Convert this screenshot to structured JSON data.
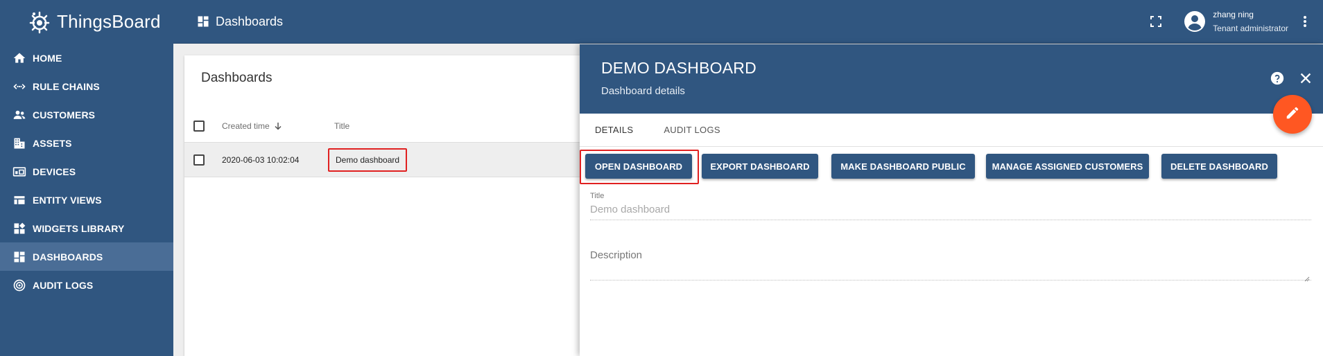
{
  "app": {
    "name": "ThingsBoard"
  },
  "sidebar": {
    "items": [
      {
        "label": "HOME",
        "icon": "home-icon"
      },
      {
        "label": "RULE CHAINS",
        "icon": "rule-chains-icon"
      },
      {
        "label": "CUSTOMERS",
        "icon": "customers-icon"
      },
      {
        "label": "ASSETS",
        "icon": "assets-icon"
      },
      {
        "label": "DEVICES",
        "icon": "devices-icon"
      },
      {
        "label": "ENTITY VIEWS",
        "icon": "entity-views-icon"
      },
      {
        "label": "WIDGETS LIBRARY",
        "icon": "widgets-library-icon"
      },
      {
        "label": "DASHBOARDS",
        "icon": "dashboards-icon",
        "active": true
      },
      {
        "label": "AUDIT LOGS",
        "icon": "audit-logs-icon"
      }
    ]
  },
  "header": {
    "title": "Dashboards",
    "user": {
      "name": "zhang ning",
      "role": "Tenant administrator"
    }
  },
  "list": {
    "title": "Dashboards",
    "columns": {
      "created_time": "Created time",
      "title": "Title"
    },
    "rows": [
      {
        "created_time": "2020-06-03 10:02:04",
        "title": "Demo dashboard"
      }
    ]
  },
  "details": {
    "title": "DEMO DASHBOARD",
    "subtitle": "Dashboard details",
    "tabs": [
      "DETAILS",
      "AUDIT LOGS"
    ],
    "actions": {
      "open": "OPEN DASHBOARD",
      "export": "EXPORT DASHBOARD",
      "make_public": "MAKE DASHBOARD PUBLIC",
      "manage_customers": "MANAGE ASSIGNED CUSTOMERS",
      "delete": "DELETE DASHBOARD"
    },
    "form": {
      "title_label": "Title",
      "title_value": "Demo dashboard",
      "description_label": "Description"
    }
  },
  "colors": {
    "primary": "#305680",
    "accent": "#ff5722",
    "highlight": "#e02020"
  }
}
